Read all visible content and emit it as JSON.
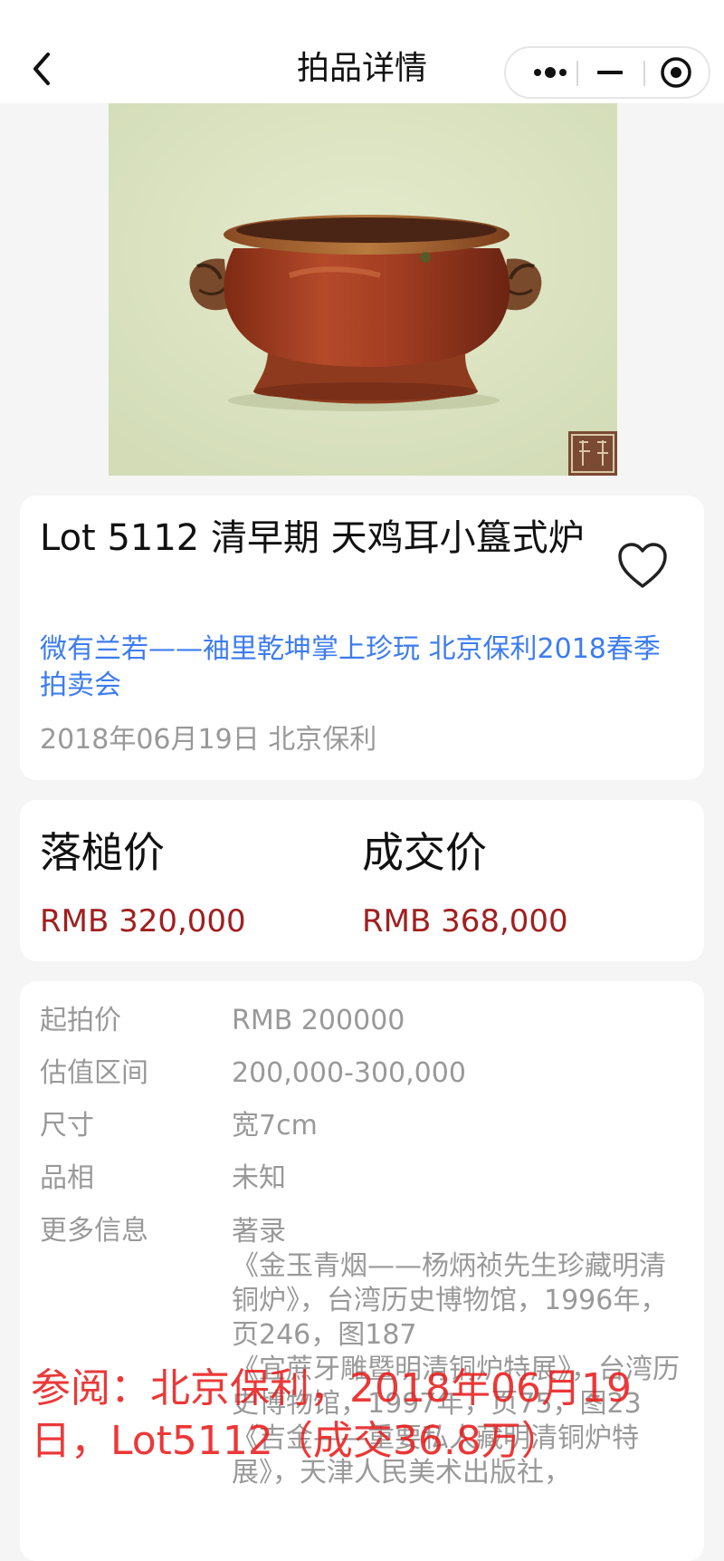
{
  "navbar": {
    "title": "拍品详情",
    "back_icon": "chevron-left-icon",
    "capsule_icons": [
      "more-dots-icon",
      "minimize-icon",
      "target-icon"
    ]
  },
  "lot": {
    "image_icon": "bronze-censer-image",
    "title": "Lot 5112 清早期 天鸡耳小簋式炉",
    "favorite_icon": "heart-icon",
    "auction_name": "微有兰若——袖里乾坤掌上珍玩 北京保利2018春季拍卖会",
    "auction_date": "2018年06月19日 北京保利"
  },
  "prices": {
    "hammer_label": "落槌价",
    "hammer_value": "RMB 320,000",
    "deal_label": "成交价",
    "deal_value": "RMB 368,000"
  },
  "details": {
    "rows": [
      {
        "label": "起拍价",
        "value": "RMB 200000"
      },
      {
        "label": "估值区间",
        "value": "200,000-300,000"
      },
      {
        "label": "尺寸",
        "value": "宽7cm"
      },
      {
        "label": "品相",
        "value": "未知"
      }
    ],
    "more_label": "更多信息",
    "more_lines": [
      "著录",
      "《金玉青烟——杨炳祯先生珍藏明清铜炉》，台湾历史博物馆，1996年，页246，图187",
      "《宜蔗牙雕暨明清铜炉特展》，台湾历史博物馆，1997年，页75，图23",
      "《吉金——重要私人藏明清铜炉特展》，天津人民美术出版社，"
    ]
  },
  "watermark": "参阅：北京保利，2018年06月19日，Lot5112（成交36.8万）",
  "colors": {
    "accent_blue": "#3d7cf0",
    "price_red": "#a11f1f",
    "watermark_red": "#e81c1c"
  }
}
